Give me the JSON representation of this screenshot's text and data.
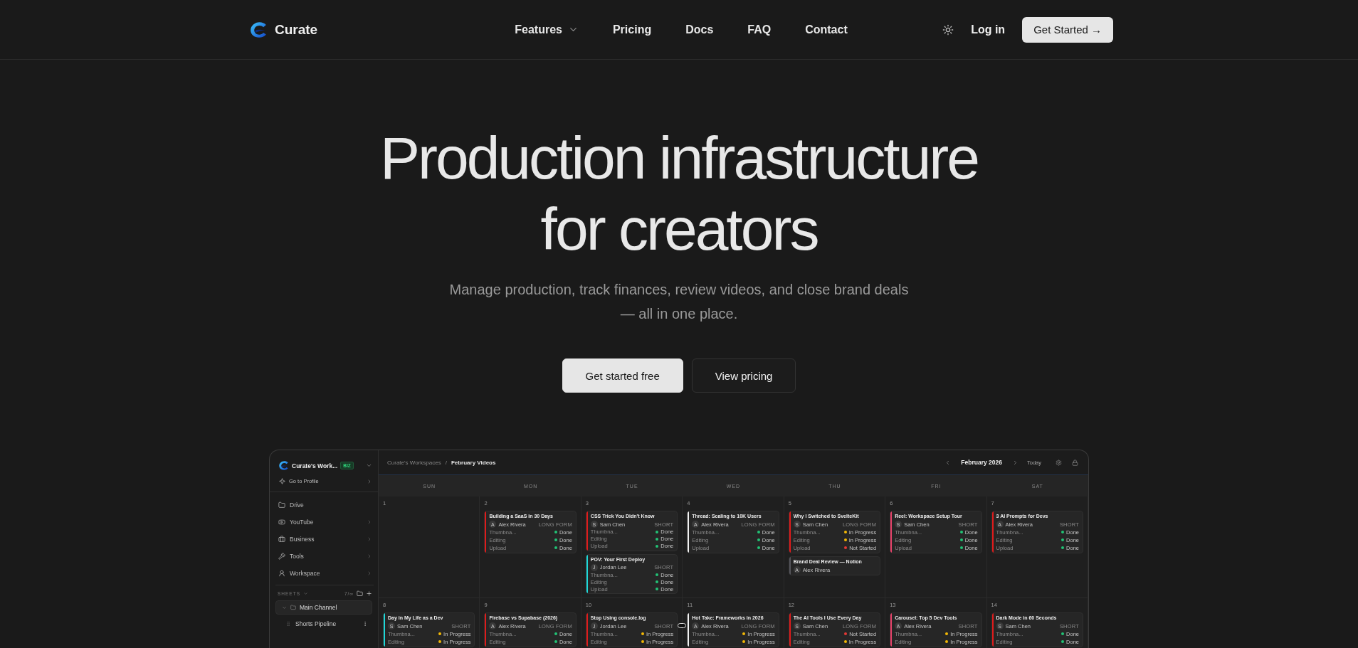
{
  "nav": {
    "brand": "Curate",
    "links": [
      {
        "label": "Features",
        "dropdown": true
      },
      {
        "label": "Pricing",
        "dropdown": false
      },
      {
        "label": "Docs",
        "dropdown": false
      },
      {
        "label": "FAQ",
        "dropdown": false
      },
      {
        "label": "Contact",
        "dropdown": false
      }
    ],
    "login": "Log in",
    "cta": "Get Started →"
  },
  "hero": {
    "title": "Production infrastructure for creators",
    "subtitle": "Manage production, track finances, review videos, and close brand deals — all in one place.",
    "buttons": [
      {
        "label": "Get started free",
        "kind": "primary"
      },
      {
        "label": "View pricing",
        "kind": "secondary"
      }
    ]
  },
  "app": {
    "sidebar": {
      "workspace": "Curate's Work...",
      "badge": "BIZ",
      "profile": "Go to Profile",
      "items": [
        {
          "label": "Drive",
          "kind": "drive",
          "expandable": false
        },
        {
          "label": "YouTube",
          "kind": "youtube",
          "expandable": true
        },
        {
          "label": "Business",
          "kind": "business",
          "expandable": true
        },
        {
          "label": "Tools",
          "kind": "tools",
          "expandable": true
        },
        {
          "label": "Workspace",
          "kind": "workspace",
          "expandable": true
        }
      ],
      "sheets_label": "SHEETS",
      "sheets_count": "7/∞",
      "sheets": [
        {
          "label": "Main Channel",
          "expanded": true,
          "selected": true,
          "children": [
            {
              "label": "Shorts Pipeline",
              "selected": false
            }
          ]
        }
      ]
    },
    "topbar": {
      "breadcrumb": [
        "Curate's Workspaces",
        "February Videos"
      ],
      "separator": "/",
      "month": "February 2026",
      "today": "Today"
    },
    "weekdays": [
      "SUN",
      "MON",
      "TUE",
      "WED",
      "THU",
      "FRI",
      "SAT"
    ],
    "weeks": [
      {
        "days": [
          {
            "day": "1"
          },
          {
            "day": "2",
            "cards": [
              {
                "title": "Building a SaaS in 30 Days",
                "initial": "A",
                "author": "Alex Rivera",
                "type": "LONG FORM",
                "color": "#e01b1b",
                "statuses": [
                  {
                    "label": "Thumbna...",
                    "color": "#22c275",
                    "text": "Done"
                  },
                  {
                    "label": "Editing",
                    "color": "#22c275",
                    "text": "Done"
                  },
                  {
                    "label": "Upload",
                    "color": "#22c275",
                    "text": "Done"
                  }
                ]
              }
            ]
          },
          {
            "day": "3",
            "cards": [
              {
                "title": "CSS Trick You Didn't Know",
                "initial": "S",
                "author": "Sam Chen",
                "type": "SHORT",
                "color": "#e01b1b",
                "statuses": [
                  {
                    "label": "Thumbna...",
                    "color": "#22c275",
                    "text": "Done"
                  },
                  {
                    "label": "Editing",
                    "color": "#22c275",
                    "text": "Done"
                  },
                  {
                    "label": "Upload",
                    "color": "#22c275",
                    "text": "Done"
                  }
                ]
              },
              {
                "title": "POV: Your First Deploy",
                "initial": "J",
                "author": "Jordan Lee",
                "type": "SHORT",
                "color": "#1ed8d8",
                "statuses": [
                  {
                    "label": "Thumbna...",
                    "color": "#22c275",
                    "text": "Done"
                  },
                  {
                    "label": "Editing",
                    "color": "#22c275",
                    "text": "Done"
                  },
                  {
                    "label": "Upload",
                    "color": "#22c275",
                    "text": "Done"
                  }
                ]
              }
            ]
          },
          {
            "day": "4",
            "cards": [
              {
                "title": "Thread: Scaling to 10K Users",
                "initial": "A",
                "author": "Alex Rivera",
                "type": "LONG FORM",
                "color": "#f2f2f2",
                "statuses": [
                  {
                    "label": "Thumbna...",
                    "color": "#22c275",
                    "text": "Done"
                  },
                  {
                    "label": "Editing",
                    "color": "#22c275",
                    "text": "Done"
                  },
                  {
                    "label": "Upload",
                    "color": "#22c275",
                    "text": "Done"
                  }
                ]
              }
            ]
          },
          {
            "day": "5",
            "cards": [
              {
                "title": "Why I Switched to SvelteKit",
                "initial": "S",
                "author": "Sam Chen",
                "type": "LONG FORM",
                "color": "#e01b1b",
                "statuses": [
                  {
                    "label": "Thumbna...",
                    "color": "#f2b705",
                    "text": "In Progress"
                  },
                  {
                    "label": "Editing",
                    "color": "#f2b705",
                    "text": "In Progress"
                  },
                  {
                    "label": "Upload",
                    "color": "#e53935",
                    "text": "Not Started"
                  }
                ]
              },
              {
                "title": "Brand Deal Review — Notion",
                "initial": "A",
                "author": "Alex Rivera",
                "color": "#55555c"
              }
            ]
          },
          {
            "day": "6",
            "cards": [
              {
                "title": "Reel: Workspace Setup Tour",
                "initial": "S",
                "author": "Sam Chen",
                "type": "SHORT",
                "color": "#e8436a",
                "statuses": [
                  {
                    "label": "Thumbna...",
                    "color": "#22c275",
                    "text": "Done"
                  },
                  {
                    "label": "Editing",
                    "color": "#22c275",
                    "text": "Done"
                  },
                  {
                    "label": "Upload",
                    "color": "#22c275",
                    "text": "Done"
                  }
                ]
              }
            ]
          },
          {
            "day": "7",
            "cards": [
              {
                "title": "3 AI Prompts for Devs",
                "initial": "A",
                "author": "Alex Rivera",
                "type": "SHORT",
                "color": "#e01b1b",
                "statuses": [
                  {
                    "label": "Thumbna...",
                    "color": "#22c275",
                    "text": "Done"
                  },
                  {
                    "label": "Editing",
                    "color": "#22c275",
                    "text": "Done"
                  },
                  {
                    "label": "Upload",
                    "color": "#22c275",
                    "text": "Done"
                  }
                ]
              }
            ]
          }
        ]
      },
      {
        "days": [
          {
            "day": "8",
            "cards": [
              {
                "title": "Day in My Life as a Dev",
                "initial": "S",
                "author": "Sam Chen",
                "type": "SHORT",
                "color": "#1ed8d8",
                "statuses": [
                  {
                    "label": "Thumbna...",
                    "color": "#f2b705",
                    "text": "In Progress"
                  },
                  {
                    "label": "Editing",
                    "color": "#f2b705",
                    "text": "In Progress"
                  }
                ]
              }
            ]
          },
          {
            "day": "9",
            "cards": [
              {
                "title": "Firebase vs Supabase (2026)",
                "initial": "A",
                "author": "Alex Rivera",
                "type": "LONG FORM",
                "color": "#e01b1b",
                "statuses": [
                  {
                    "label": "Thumbna...",
                    "color": "#22c275",
                    "text": "Done"
                  },
                  {
                    "label": "Editing",
                    "color": "#22c275",
                    "text": "Done"
                  }
                ]
              }
            ]
          },
          {
            "day": "10",
            "cards": [
              {
                "title": "Stop Using console.log",
                "initial": "J",
                "author": "Jordan Lee",
                "type": "SHORT",
                "color": "#e01b1b",
                "statuses": [
                  {
                    "label": "Thumbna...",
                    "color": "#f2b705",
                    "text": "In Progress"
                  },
                  {
                    "label": "Editing",
                    "color": "#f2b705",
                    "text": "In Progress"
                  }
                ]
              }
            ]
          },
          {
            "day": "11",
            "cards": [
              {
                "title": "Hot Take: Frameworks in 2026",
                "initial": "A",
                "author": "Alex Rivera",
                "type": "LONG FORM",
                "color": "#f2f2f2",
                "statuses": [
                  {
                    "label": "Thumbna...",
                    "color": "#f2b705",
                    "text": "In Progress"
                  },
                  {
                    "label": "Editing",
                    "color": "#f2b705",
                    "text": "In Progress"
                  }
                ]
              }
            ]
          },
          {
            "day": "12",
            "cards": [
              {
                "title": "The AI Tools I Use Every Day",
                "initial": "S",
                "author": "Sam Chen",
                "type": "LONG FORM",
                "color": "#e01b1b",
                "statuses": [
                  {
                    "label": "Thumbna...",
                    "color": "#e53935",
                    "text": "Not Started"
                  },
                  {
                    "label": "Editing",
                    "color": "#f2b705",
                    "text": "In Progress"
                  }
                ]
              }
            ]
          },
          {
            "day": "13",
            "cards": [
              {
                "title": "Carousel: Top 5 Dev Tools",
                "initial": "A",
                "author": "Alex Rivera",
                "type": "SHORT",
                "color": "#e8436a",
                "statuses": [
                  {
                    "label": "Thumbna...",
                    "color": "#f2b705",
                    "text": "In Progress"
                  },
                  {
                    "label": "Editing",
                    "color": "#f2b705",
                    "text": "In Progress"
                  }
                ]
              }
            ]
          },
          {
            "day": "14",
            "cards": [
              {
                "title": "Dark Mode in 60 Seconds",
                "initial": "S",
                "author": "Sam Chen",
                "type": "SHORT",
                "color": "#e01b1b",
                "statuses": [
                  {
                    "label": "Thumbna...",
                    "color": "#22c275",
                    "text": "Done"
                  },
                  {
                    "label": "Editing",
                    "color": "#22c275",
                    "text": "Done"
                  }
                ]
              }
            ]
          }
        ]
      }
    ]
  }
}
